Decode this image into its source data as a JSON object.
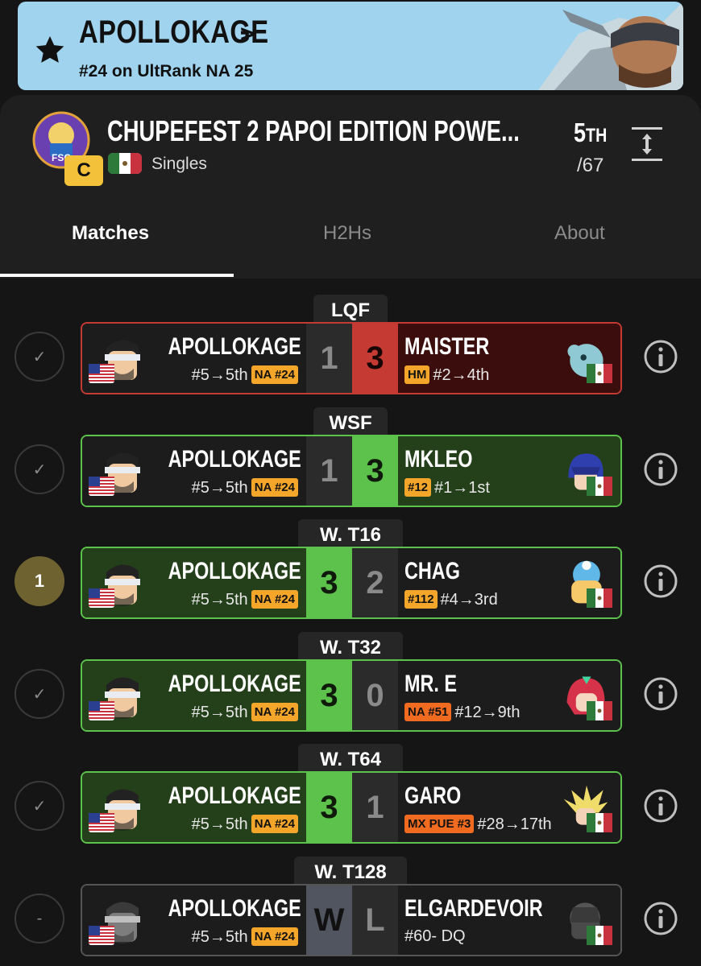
{
  "banner": {
    "player_name": "APOLLOKAGE",
    "chevron": ">",
    "rank_line": "#24 on UltRank NA 25",
    "icon": "star-icon"
  },
  "event": {
    "title": "CHUPEFEST 2 PAPOI EDITION POWE...",
    "tier": "C",
    "type": "Singles",
    "placing": "5",
    "placing_suffix": "TH",
    "entrants": "/67",
    "country_flag": "mexico-flag-icon",
    "expand_icon": "expand-icon"
  },
  "tabs": [
    {
      "label": "Matches",
      "active": true
    },
    {
      "label": "H2Hs",
      "active": false
    },
    {
      "label": "About",
      "active": false
    }
  ],
  "matches": [
    {
      "round": "LQF",
      "status": "check",
      "status_label": "✓",
      "left": {
        "name": "APOLLOKAGE",
        "seed_line": "#5→5th",
        "tag": "NA #24"
      },
      "scores": [
        "1",
        "3"
      ],
      "right": {
        "name": "MAISTER",
        "tag": "HM",
        "seed_line": "#2→4th"
      }
    },
    {
      "round": "WSF",
      "status": "check",
      "status_label": "✓",
      "left": {
        "name": "APOLLOKAGE",
        "seed_line": "#5→5th",
        "tag": "NA #24"
      },
      "scores": [
        "1",
        "3"
      ],
      "right": {
        "name": "MKLEO",
        "tag": "#12",
        "seed_line": "#1→1st"
      }
    },
    {
      "round": "W. T16",
      "status": "count",
      "status_label": "1",
      "left": {
        "name": "APOLLOKAGE",
        "seed_line": "#5→5th",
        "tag": "NA #24"
      },
      "scores": [
        "3",
        "2"
      ],
      "right": {
        "name": "CHAG",
        "tag": "#112",
        "seed_line": "#4→3rd"
      }
    },
    {
      "round": "W. T32",
      "status": "check",
      "status_label": "✓",
      "left": {
        "name": "APOLLOKAGE",
        "seed_line": "#5→5th",
        "tag": "NA #24"
      },
      "scores": [
        "3",
        "0"
      ],
      "right": {
        "name": "MR. E",
        "tag": "NA #51",
        "seed_line": "#12→9th"
      }
    },
    {
      "round": "W. T64",
      "status": "check",
      "status_label": "✓",
      "left": {
        "name": "APOLLOKAGE",
        "seed_line": "#5→5th",
        "tag": "NA #24"
      },
      "scores": [
        "3",
        "1"
      ],
      "right": {
        "name": "GARO",
        "tag": "MX PUE #3",
        "seed_line": "#28→17th"
      }
    },
    {
      "round": "W. T128",
      "status": "dash",
      "status_label": "-",
      "left": {
        "name": "APOLLOKAGE",
        "seed_line": "#5→5th",
        "tag": "NA #24"
      },
      "scores": [
        "W",
        "L"
      ],
      "right": {
        "name": "ELGARDEVOIR",
        "tag": "",
        "seed_line": "#60- DQ"
      }
    }
  ],
  "colors": {
    "win_green": "#5cc24c",
    "loss_red": "#c53a32",
    "tag_gold": "#f4a62a",
    "banner_blue": "#9fd3ee"
  }
}
